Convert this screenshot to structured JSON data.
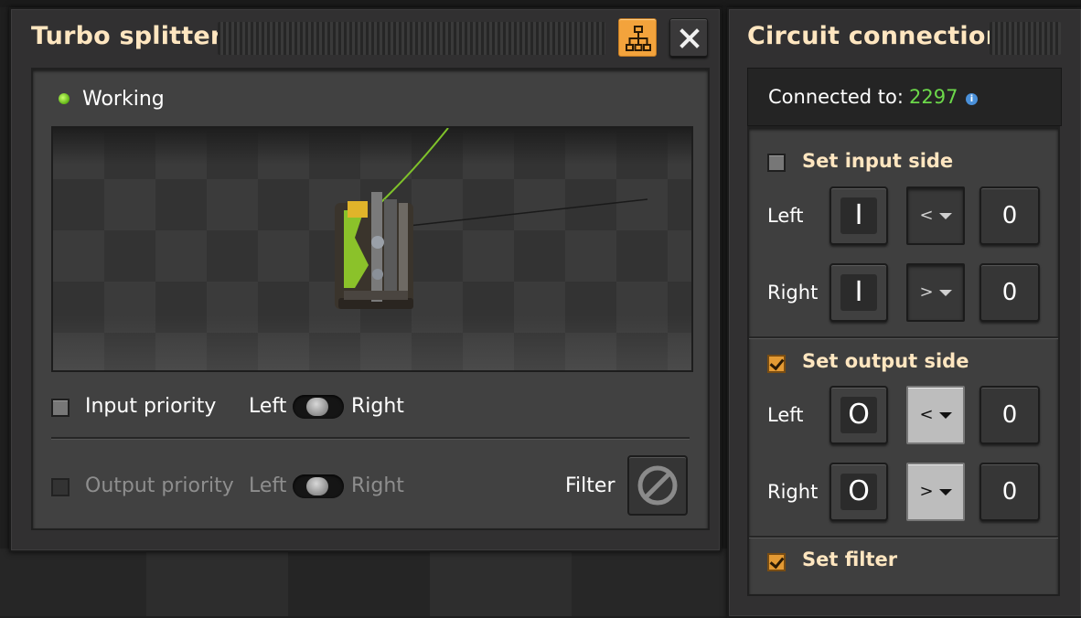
{
  "splitter_window": {
    "title": "Turbo splitter",
    "status": "Working",
    "input_priority": {
      "label": "Input priority",
      "left": "Left",
      "right": "Right",
      "checked": false
    },
    "output_priority": {
      "label": "Output priority",
      "left": "Left",
      "right": "Right",
      "checked": false,
      "disabled": true
    },
    "filter_label": "Filter",
    "icons": {
      "network": "network-hierarchy-icon",
      "close": "close-icon",
      "filter": "no-filter-icon"
    },
    "colors": {
      "accent": "#f3a33c",
      "status": "#7bd62a"
    }
  },
  "circuit_window": {
    "title": "Circuit connection",
    "connected_label": "Connected to:",
    "connected_value": "2297",
    "input_side": {
      "label": "Set input side",
      "checked": false,
      "left": {
        "label": "Left",
        "signal": "I",
        "comparator": "<",
        "value": "0"
      },
      "right": {
        "label": "Right",
        "signal": "I",
        "comparator": ">",
        "value": "0"
      }
    },
    "output_side": {
      "label": "Set output side",
      "checked": true,
      "left": {
        "label": "Left",
        "signal": "O",
        "comparator": "<",
        "value": "0"
      },
      "right": {
        "label": "Right",
        "signal": "O",
        "comparator": ">",
        "value": "0"
      }
    },
    "filter": {
      "label": "Set filter",
      "checked": true
    }
  }
}
